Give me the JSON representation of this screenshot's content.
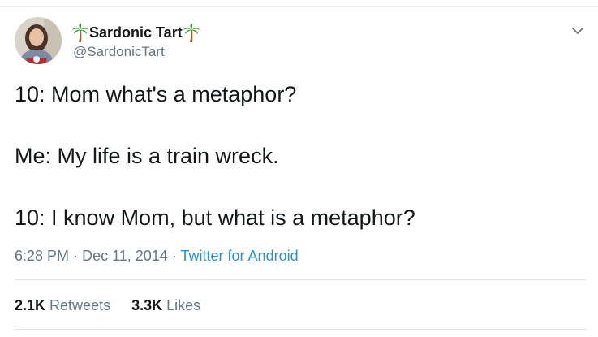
{
  "account": {
    "display_name": "Sardonic Tart",
    "handle": "@SardonicTart",
    "name_emoji": "palm-tree-icon"
  },
  "tweet": {
    "lines": [
      "10: Mom what's a metaphor?",
      "Me: My life is a train wreck.",
      "10: I know Mom, but what is a metaphor?"
    ]
  },
  "meta": {
    "time": "6:28 PM",
    "separator": "·",
    "date": "Dec 11, 2014",
    "source": "Twitter for Android"
  },
  "stats": {
    "retweets_count": "2.1K",
    "retweets_label": "Retweets",
    "likes_count": "3.3K",
    "likes_label": "Likes"
  },
  "colors": {
    "secondary_text": "#657786",
    "link": "#1b95e0",
    "divider": "#e6ecf0"
  }
}
